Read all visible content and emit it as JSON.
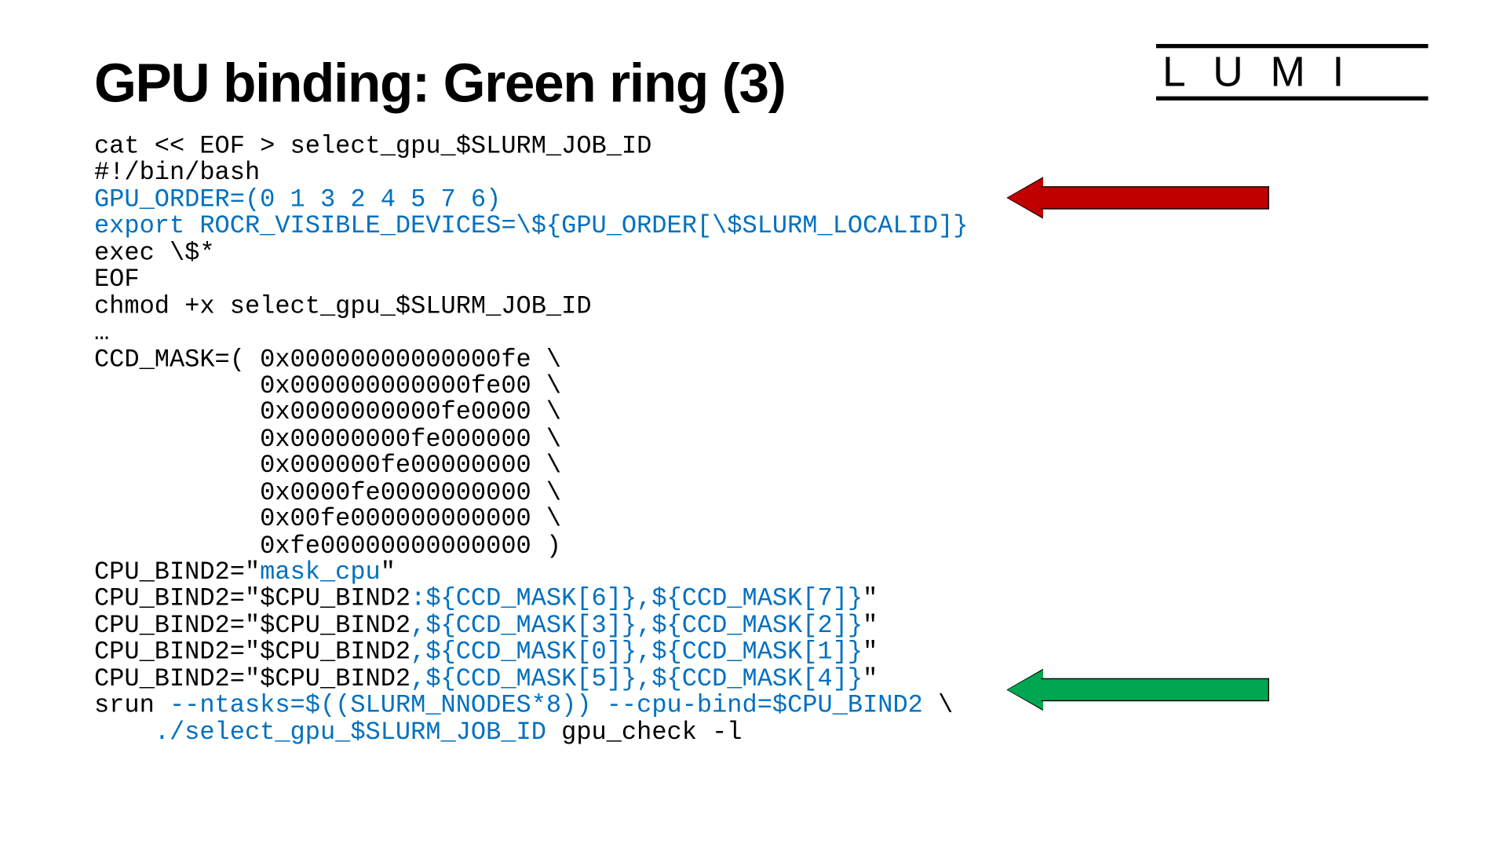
{
  "slide": {
    "title": "GPU binding: Green ring (3)",
    "logo_text": "LUMI",
    "code": {
      "l01": "cat << EOF > select_gpu_$SLURM_JOB_ID",
      "l02": "#!/bin/bash",
      "l03": "GPU_ORDER=(0 1 3 2 4 5 7 6)",
      "l04": "export ROCR_VISIBLE_DEVICES=\\${GPU_ORDER[\\$SLURM_LOCALID]}",
      "l05": "exec \\$*",
      "l06": "EOF",
      "l07": "chmod +x select_gpu_$SLURM_JOB_ID",
      "l08": "…",
      "l09": "CCD_MASK=( 0x00000000000000fe \\",
      "l10": "           0x000000000000fe00 \\",
      "l11": "           0x0000000000fe0000 \\",
      "l12": "           0x00000000fe000000 \\",
      "l13": "           0x000000fe00000000 \\",
      "l14": "           0x0000fe0000000000 \\",
      "l15": "           0x00fe000000000000 \\",
      "l16": "           0xfe00000000000000 )",
      "l17a": "CPU_BIND2=\"",
      "l17b": "mask_cpu",
      "l17c": "\"",
      "l18a": "CPU_BIND2=\"$CPU_BIND2",
      "l18b": ":${CCD_MASK[6]},${CCD_MASK[7]}",
      "l18c": "\"",
      "l19a": "CPU_BIND2=\"$CPU_BIND2",
      "l19b": ",${CCD_MASK[3]},${CCD_MASK[2]}",
      "l19c": "\"",
      "l20a": "CPU_BIND2=\"$CPU_BIND2",
      "l20b": ",${CCD_MASK[0]},${CCD_MASK[1]}",
      "l20c": "\"",
      "l21a": "CPU_BIND2=\"$CPU_BIND2",
      "l21b": ",${CCD_MASK[5]},${CCD_MASK[4]}",
      "l21c": "\"",
      "l22a": "srun ",
      "l22b": "--ntasks=$((SLURM_NNODES*8)) --cpu-bind=$CPU_BIND2",
      "l22c": " \\",
      "l23a": "    ",
      "l23b": "./select_gpu_$SLURM_JOB_ID",
      "l23c": " gpu_check -l"
    }
  }
}
